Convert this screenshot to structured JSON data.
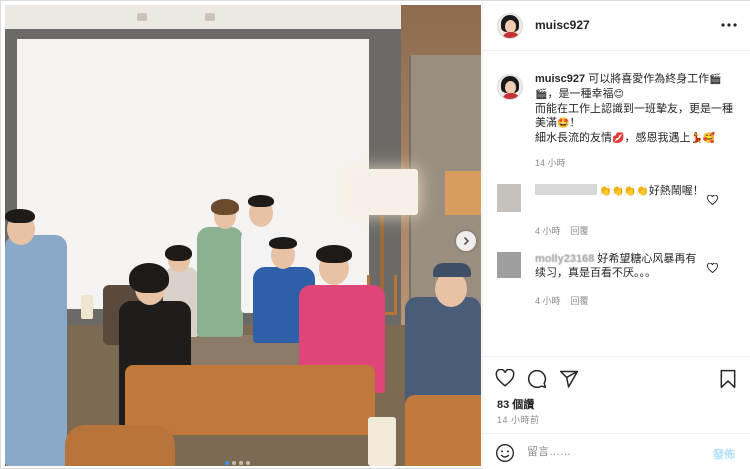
{
  "header": {
    "username": "muisc927"
  },
  "caption": {
    "username": "muisc927",
    "line1": " 可以將喜愛作為終身工作",
    "emoji1": "🎬",
    "line1b": "，是一種幸福",
    "emoji2": "😊",
    "line2": "而能在工作上認識到一班摯友，更是一種美滿",
    "emoji3": "🤩",
    "line2b": "！",
    "line3": "細水長流的友情",
    "emoji4": "💋",
    "line3b": "，感恩我遇上",
    "emoji5": "💃",
    "emoji6": "🥰",
    "time": "14 小時"
  },
  "comments": [
    {
      "emojis": "👏👏👏👏",
      "text": "好熱鬧喔！",
      "time": "4 小時",
      "reply": "回覆"
    },
    {
      "name": "molly23168",
      "text": "好希望糖心风暴再有续习，真是百看不厌。。。",
      "time": "4 小時",
      "reply": "回覆"
    }
  ],
  "actions": {
    "likes": "83 個讚",
    "posted": "14 小時前"
  },
  "add_comment": {
    "placeholder": "留言……",
    "post_label": "發佈"
  },
  "colors": {
    "accent": "#3897f0",
    "post_button_disabled": "#b2dffc",
    "meta_text": "#8e8e8e"
  },
  "icons": {
    "more": "more-horizontal-icon",
    "like": "heart-icon",
    "comment": "comment-bubble-icon",
    "share": "paper-plane-icon",
    "save": "bookmark-icon",
    "emoji": "smiley-icon",
    "next": "chevron-right-icon"
  }
}
